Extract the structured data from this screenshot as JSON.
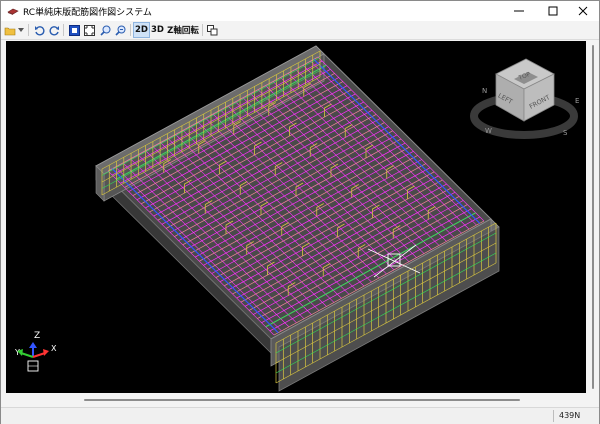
{
  "window": {
    "title": "RC単純床版配筋図作図システム"
  },
  "toolbar": {
    "btn_2d": "2D",
    "btn_3d": "3D",
    "btn_zrotate": "Z軸回転"
  },
  "viewcube": {
    "top": "TOP",
    "left": "LEFT",
    "front": "FRONT",
    "compass": [
      "N",
      "E",
      "S",
      "W"
    ]
  },
  "axes": {
    "z": "Z",
    "y": "Y",
    "x": "X"
  },
  "status": {
    "text": "439N"
  },
  "colors": {
    "viewport_bg": "#000000",
    "concrete": "#7a7a7a",
    "rebar_magenta": "#ff33ff",
    "rebar_yellow": "#d8c640",
    "rebar_green": "#33dd55",
    "rebar_blue": "#3355ff",
    "rebar_red": "#ff3333"
  }
}
